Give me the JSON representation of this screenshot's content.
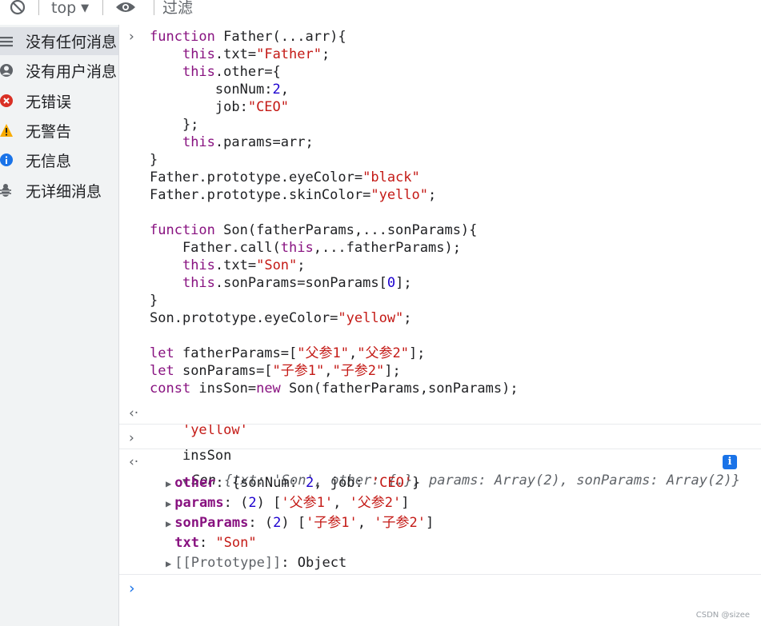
{
  "toolbar": {
    "context": "top",
    "filter_placeholder": "过滤"
  },
  "sidebar": {
    "items": [
      {
        "label": "没有任何消息",
        "icon": "list-icon",
        "selected": true
      },
      {
        "label": "没有用户消息",
        "icon": "user-icon",
        "selected": false
      },
      {
        "label": "无错误",
        "icon": "error-icon",
        "selected": false
      },
      {
        "label": "无警告",
        "icon": "warning-icon",
        "selected": false
      },
      {
        "label": "无信息",
        "icon": "info-icon",
        "selected": false
      },
      {
        "label": "无详细消息",
        "icon": "bug-icon",
        "selected": false
      }
    ]
  },
  "console": {
    "code_lines": [
      "function Father(...arr){",
      "    this.txt=\"Father\";",
      "    this.other={",
      "        sonNum:2,",
      "        job:\"CEO\"",
      "    };",
      "    this.params=arr;",
      "}",
      "Father.prototype.eyeColor=\"black\"",
      "Father.prototype.skinColor=\"yello\";",
      "",
      "function Son(fatherParams,...sonParams){",
      "    Father.call(this,...fatherParams);",
      "    this.txt=\"Son\";",
      "    this.sonParams=sonParams[0];",
      "}",
      "Son.prototype.eyeColor=\"yellow\";",
      "",
      "let fatherParams=[\"父参1\",\"父参2\"];",
      "let sonParams=[\"子参1\",\"子参2\"];",
      "const insSon=new Son(fatherParams,sonParams);"
    ],
    "result_1": "'yellow'",
    "input_2": "insSon",
    "object_summary": {
      "class": "Son",
      "text": "{txt: 'Son', other: {…}, params: Array(2), sonParams: Array(2)}"
    },
    "object_props": [
      {
        "key": "other",
        "value": "{sonNum: 2, job: 'CEO'}",
        "expandable": true
      },
      {
        "key": "params",
        "value": "(2) ['父参1', '父参2']",
        "expandable": true
      },
      {
        "key": "sonParams",
        "value": "(2) ['子参1', '子参2']",
        "expandable": true
      },
      {
        "key": "txt",
        "value": "\"Son\"",
        "expandable": false
      },
      {
        "key": "[[Prototype]]",
        "value": "Object",
        "expandable": true
      }
    ]
  },
  "watermark": "CSDN @sizee"
}
